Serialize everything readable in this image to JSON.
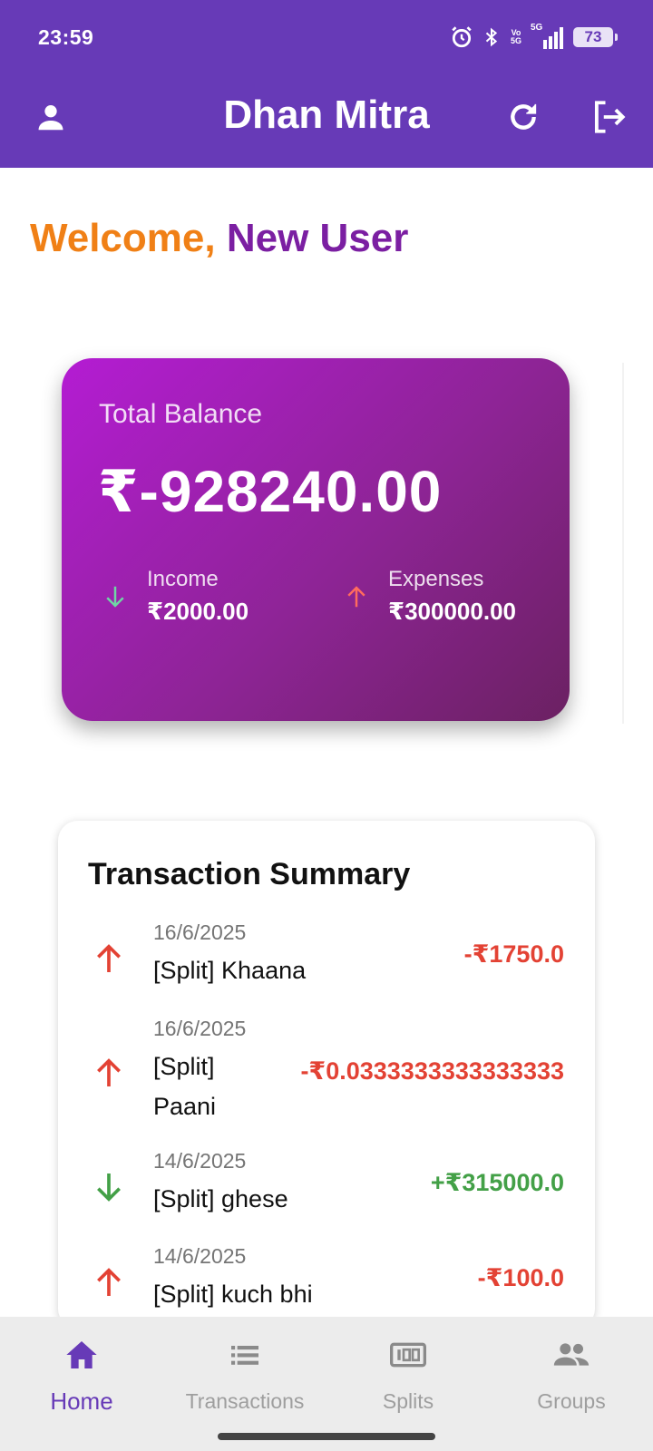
{
  "status_bar": {
    "time": "23:59",
    "volte_top": "Vo",
    "volte_bottom": "5G",
    "network": "5G",
    "battery": "73"
  },
  "app_bar": {
    "title": "Dhan Mitra",
    "icons": [
      "person-icon",
      "refresh-icon",
      "logout-icon"
    ]
  },
  "welcome": {
    "greeting": "Welcome,",
    "name": "New User"
  },
  "balance_card": {
    "label": "Total Balance",
    "amount": "₹-928240.00",
    "income_label": "Income",
    "income_value": "₹2000.00",
    "expenses_label": "Expenses",
    "expenses_value": "₹300000.00",
    "colors": {
      "gradient_start": "#B41CD3",
      "gradient_end": "#6B2162",
      "income_arrow": "#6FD6A5",
      "expense_arrow": "#FF6B5E"
    }
  },
  "summary": {
    "title": "Transaction Summary",
    "transactions": [
      {
        "date": "16/6/2025",
        "description": "[Split] Khaana",
        "amount": "-₹1750.0",
        "type": "expense"
      },
      {
        "date": "16/6/2025",
        "description": "[Split] Paani",
        "amount": "-₹0.0333333333333333",
        "type": "expense"
      },
      {
        "date": "14/6/2025",
        "description": "[Split] ghese",
        "amount": "+₹315000.0",
        "type": "income"
      },
      {
        "date": "14/6/2025",
        "description": "[Split] kuch bhi",
        "amount": "-₹100.0",
        "type": "expense"
      }
    ]
  },
  "bottom_nav": {
    "items": [
      {
        "label": "Home",
        "icon": "home-icon",
        "active": true
      },
      {
        "label": "Transactions",
        "icon": "list-icon",
        "active": false
      },
      {
        "label": "Splits",
        "icon": "splits-icon",
        "active": false
      },
      {
        "label": "Groups",
        "icon": "groups-icon",
        "active": false
      }
    ]
  },
  "theme": {
    "primary": "#673AB7",
    "accent_orange": "#F08016",
    "accent_purple": "#7B1FA2",
    "negative": "#E34234",
    "positive": "#43A047"
  }
}
